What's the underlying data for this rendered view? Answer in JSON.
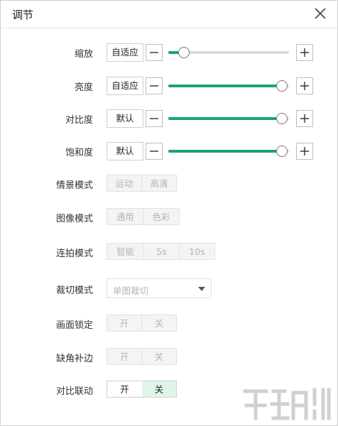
{
  "window": {
    "title": "调节"
  },
  "rows": {
    "zoom": {
      "label": "缩放",
      "mode": "自适应",
      "level_percent": 13
    },
    "brightness": {
      "label": "亮度",
      "mode": "自适应",
      "level_percent": 94
    },
    "contrast": {
      "label": "对比度",
      "mode": "默认",
      "level_percent": 94
    },
    "saturation": {
      "label": "饱和度",
      "mode": "默认",
      "level_percent": 94
    },
    "scene_mode": {
      "label": "情景模式",
      "options": [
        "运动",
        "高清"
      ]
    },
    "image_mode": {
      "label": "图像模式",
      "options": [
        "通用",
        "色彩"
      ]
    },
    "burst_mode": {
      "label": "连拍模式",
      "options": [
        "智能",
        "5s",
        "10s"
      ]
    },
    "crop_mode": {
      "label": "裁切模式",
      "selected": "单图裁切"
    },
    "lock_frame": {
      "label": "画面锁定",
      "options": [
        "开",
        "关"
      ]
    },
    "fill_corner": {
      "label": "缺角补边",
      "options": [
        "开",
        "关"
      ]
    },
    "contrast_link": {
      "label": "对比联动",
      "options": [
        "开",
        "关"
      ],
      "selected": "关"
    }
  },
  "colors": {
    "accent": "#1aa56e",
    "selected_bg": "#dff5ea"
  },
  "icons": {
    "close": "close-icon",
    "minus": "minus-icon",
    "plus": "plus-icon",
    "dropdown": "caret-down-icon"
  }
}
